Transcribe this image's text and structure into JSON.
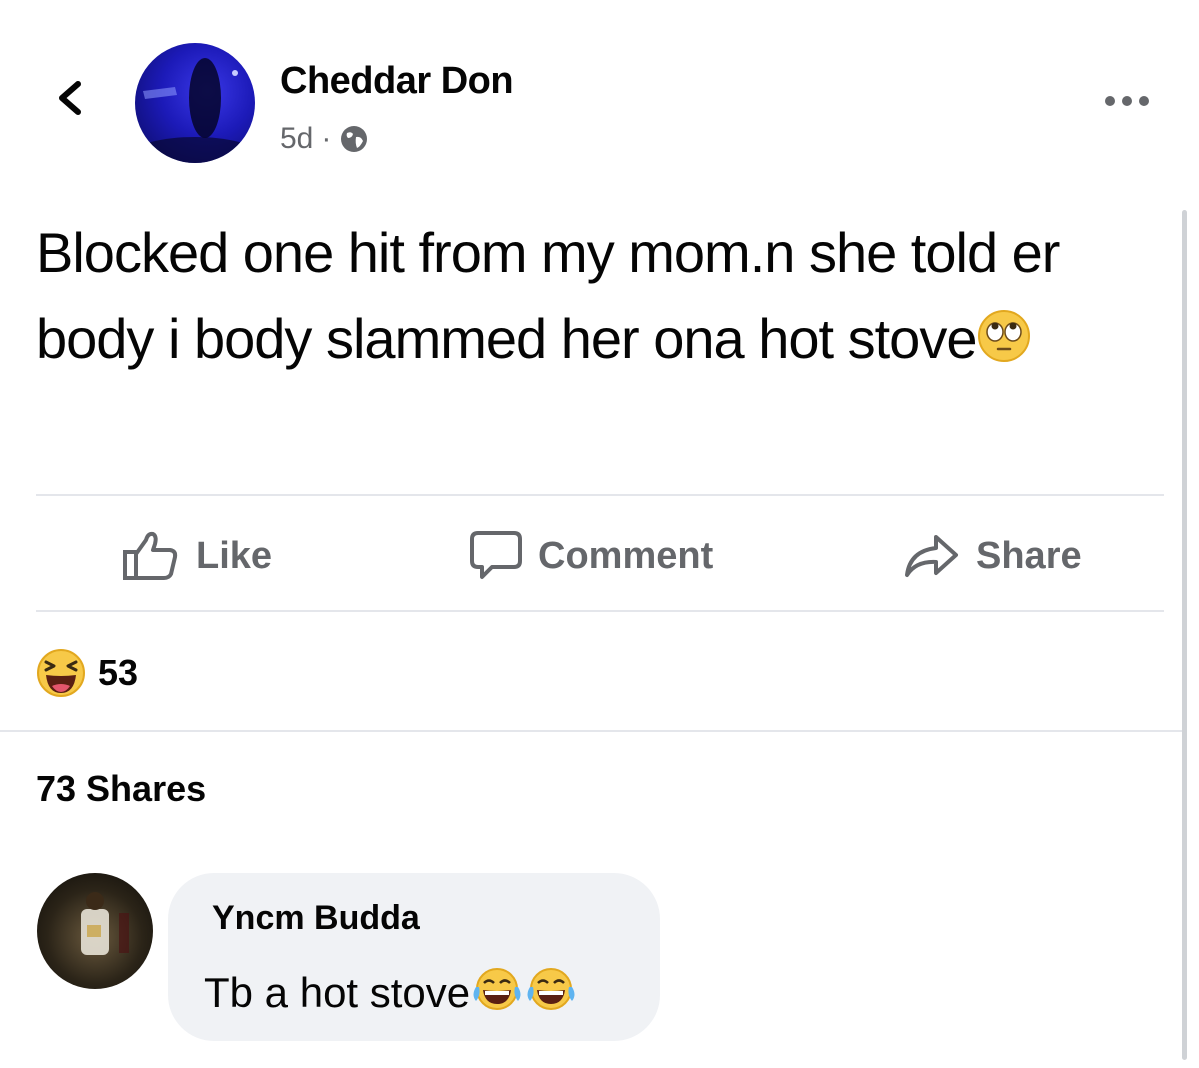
{
  "post": {
    "author": "Cheddar Don",
    "time": "5d",
    "meta_separator": "·",
    "privacy_icon": "globe-icon",
    "text": "Blocked one hit from my mom.n she told er body i body slammed her ona hot stove",
    "text_emoji": "face-with-rolling-eyes"
  },
  "actions": {
    "like": "Like",
    "comment": "Comment",
    "share": "Share"
  },
  "reactions": {
    "icon": "laughing-face",
    "count": "53"
  },
  "shares": "73 Shares",
  "comment": {
    "author": "Yncm Budda",
    "text": "Tb a hot stove",
    "emojis": [
      "face-with-tears-of-joy",
      "face-with-tears-of-joy"
    ]
  },
  "colors": {
    "text": "#050505",
    "secondary": "#65676b",
    "divider": "#e4e6eb",
    "bubble": "#f0f2f5"
  }
}
